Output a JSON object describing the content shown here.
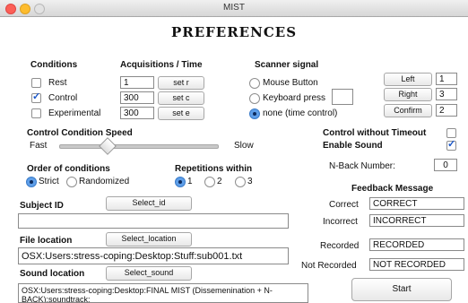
{
  "window": {
    "title": "MIST"
  },
  "header": {
    "title": "PREFERENCES"
  },
  "conditions": {
    "heading": "Conditions",
    "acq_heading": "Acquisitions / Time",
    "rows": [
      {
        "label": "Rest",
        "checked": false,
        "value": "1",
        "button": "set r"
      },
      {
        "label": "Control",
        "checked": true,
        "value": "300",
        "button": "set c"
      },
      {
        "label": "Experimental",
        "checked": false,
        "value": "300",
        "button": "set e"
      }
    ]
  },
  "scanner": {
    "heading": "Scanner signal",
    "options": [
      "Mouse Button",
      "Keyboard press",
      "none (time control)"
    ],
    "selected": "none (time control)",
    "keyboard_value": ""
  },
  "keys": [
    {
      "button": "Left",
      "value": "1"
    },
    {
      "button": "Right",
      "value": "3"
    },
    {
      "button": "Confirm",
      "value": "2"
    }
  ],
  "speed": {
    "heading": "Control Condition Speed",
    "fast": "Fast",
    "slow": "Slow",
    "level": 0.3
  },
  "control_without_timeout": {
    "label": "Control without Timeout",
    "checked": false
  },
  "enable_sound": {
    "label": "Enable Sound",
    "checked": true
  },
  "nback": {
    "label": "N-Back Number:",
    "value": "0"
  },
  "order": {
    "heading": "Order of conditions",
    "options": [
      "Strict",
      "Randomized"
    ],
    "selected": "Strict"
  },
  "repetitions": {
    "heading": "Repetitions within",
    "options": [
      "1",
      "2",
      "3"
    ],
    "selected": "1"
  },
  "feedback": {
    "heading": "Feedback Message",
    "rows": [
      {
        "label": "Correct",
        "value": "CORRECT"
      },
      {
        "label": "Incorrect",
        "value": "INCORRECT"
      },
      {
        "label": "Recorded",
        "value": "RECORDED"
      },
      {
        "label": "Not Recorded",
        "value": "NOT RECORDED"
      }
    ]
  },
  "subject": {
    "label": "Subject ID",
    "button": "Select_id",
    "value": ""
  },
  "file": {
    "label": "File location",
    "button": "Select_location",
    "value": "OSX:Users:stress-coping:Desktop:Stuff:sub001.txt"
  },
  "sound": {
    "label": "Sound location",
    "button": "Select_sound",
    "value": "OSX:Users:stress-coping:Desktop:FINAL MIST (Dissemenination + N-BACK):soundtrack:"
  },
  "start_button": "Start",
  "colors": {
    "accent": "#3b7cc9",
    "checkmark": "#1a56c8"
  }
}
